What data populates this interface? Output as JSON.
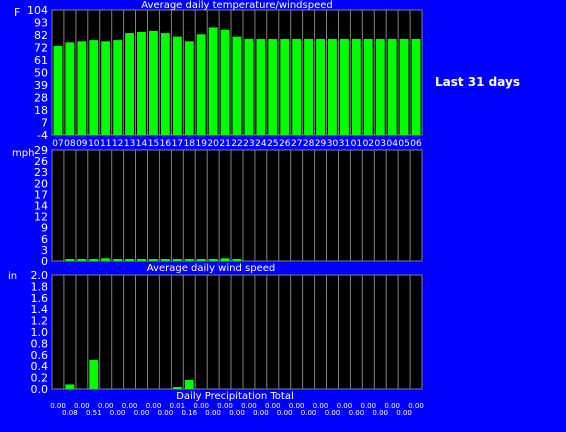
{
  "side_label": "Last 31 days",
  "colors": {
    "background": "#0000ff",
    "panel": "#000000",
    "bar": "#00ff00",
    "grid": "#808080",
    "text": "#ffffff"
  },
  "day_labels": [
    {
      "text": "07",
      "slot": 0
    },
    {
      "text": "08",
      "slot": 1
    },
    {
      "text": "09",
      "slot": 2
    },
    {
      "text": "10",
      "slot": 3
    },
    {
      "text": "11",
      "slot": 4
    },
    {
      "text": "12",
      "slot": 5
    },
    {
      "text": "13",
      "slot": 6
    },
    {
      "text": "14",
      "slot": 7
    },
    {
      "text": "15",
      "slot": 8
    },
    {
      "text": "16",
      "slot": 9
    },
    {
      "text": "17",
      "slot": 10
    },
    {
      "text": "18",
      "slot": 11
    },
    {
      "text": "19",
      "slot": 12
    },
    {
      "text": "20",
      "slot": 13
    },
    {
      "text": "21",
      "slot": 14
    },
    {
      "text": "22",
      "slot": 15
    },
    {
      "text": "23",
      "slot": 16
    },
    {
      "text": "24",
      "slot": 17
    },
    {
      "text": "25",
      "slot": 18
    },
    {
      "text": "26",
      "slot": 19
    },
    {
      "text": "27",
      "slot": 20
    },
    {
      "text": "28",
      "slot": 21
    },
    {
      "text": "29",
      "slot": 22
    },
    {
      "text": "30",
      "slot": 23
    },
    {
      "text": "31",
      "slot": 24
    },
    {
      "text": "01",
      "slot": 25
    },
    {
      "text": "02",
      "slot": 26
    },
    {
      "text": "03",
      "slot": 27
    },
    {
      "text": "04",
      "slot": 28
    },
    {
      "text": "05",
      "slot": 29
    },
    {
      "text": "06",
      "slot": 30
    }
  ],
  "chart_data": [
    {
      "type": "bar",
      "title": "Average daily temperature/windspeed",
      "ylabel": "F",
      "ylim": [
        -4,
        104
      ],
      "yticks": [
        "104",
        "93",
        "82",
        "72",
        "61",
        "50",
        "39",
        "28",
        "18",
        "7",
        "-4"
      ],
      "values": [
        73,
        76,
        77,
        78,
        77,
        78,
        84,
        85,
        86,
        84,
        81,
        77,
        83,
        89,
        87,
        81,
        79,
        79,
        79,
        79,
        79,
        79,
        79,
        79,
        79,
        79,
        79,
        79,
        79,
        79,
        79
      ]
    },
    {
      "type": "bar",
      "title": "Average daily wind speed",
      "ylabel": "mph",
      "ylim": [
        0,
        29
      ],
      "yticks": [
        "29",
        "26",
        "23",
        "20",
        "17",
        "14",
        "12",
        "9",
        "6",
        "3",
        "0"
      ],
      "values": [
        0,
        0.4,
        0.4,
        0.4,
        0.7,
        0.4,
        0.4,
        0.4,
        0.4,
        0.4,
        0.4,
        0.4,
        0.4,
        0.4,
        0.7,
        0.4,
        0,
        0,
        0,
        0,
        0,
        0,
        0,
        0,
        0,
        0,
        0,
        0,
        0,
        0,
        0
      ]
    },
    {
      "type": "bar",
      "title": "Daily Precipitation Total",
      "ylabel": "in",
      "ylim": [
        0,
        2.0
      ],
      "yticks": [
        "2.0",
        "1.8",
        "1.6",
        "1.4",
        "1.2",
        "1.0",
        "0.8",
        "0.6",
        "0.4",
        "0.2",
        "0.0"
      ],
      "values": [
        0.0,
        0.08,
        0.0,
        0.51,
        0.0,
        0.0,
        0.0,
        0.0,
        0.0,
        0.0,
        0.01,
        0.16,
        0.0,
        0.0,
        0.0,
        0.0,
        0.0,
        0.0,
        0.0,
        0.0,
        0.0,
        0.0,
        0.0,
        0.0,
        0.0,
        0.0,
        0.0,
        0.0,
        0.0,
        0.0,
        0.0
      ],
      "value_labels": [
        "0.00",
        "0.08",
        "0.00",
        "0.51",
        "0.00",
        "0.00",
        "0.00",
        "0.00",
        "0.00",
        "0.00",
        "0.01",
        "0.16",
        "0.00",
        "0.00",
        "0.00",
        "0.00",
        "0.00",
        "0.00",
        "0.00",
        "0.00",
        "0.00",
        "0.00",
        "0.00",
        "0.00",
        "0.00",
        "0.00",
        "0.00",
        "0.00",
        "0.00",
        "0.00",
        "0.00"
      ]
    }
  ]
}
